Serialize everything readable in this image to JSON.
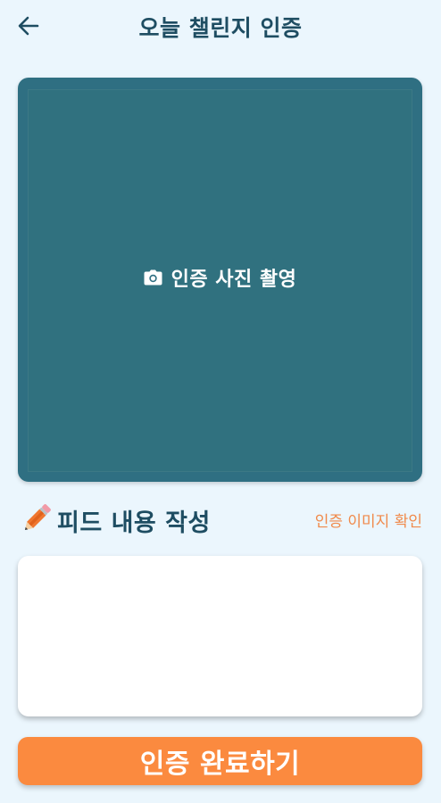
{
  "header": {
    "title": "오늘 챌린지 인증",
    "back_icon": "arrow-left-icon"
  },
  "photo": {
    "label": "인증 사진 촬영",
    "icon": "camera-icon"
  },
  "feed": {
    "section_title": "피드 내용 작성",
    "section_icon": "pencil-icon",
    "check_image_link": "인증 이미지 확인",
    "input_value": "",
    "input_placeholder": ""
  },
  "submit": {
    "label": "인증 완료하기"
  },
  "colors": {
    "background": "#ebf6fd",
    "primary_text": "#1e4d62",
    "photo_area": "#2f6f82",
    "accent": "#fb8a3f",
    "link": "#f08a4b"
  }
}
